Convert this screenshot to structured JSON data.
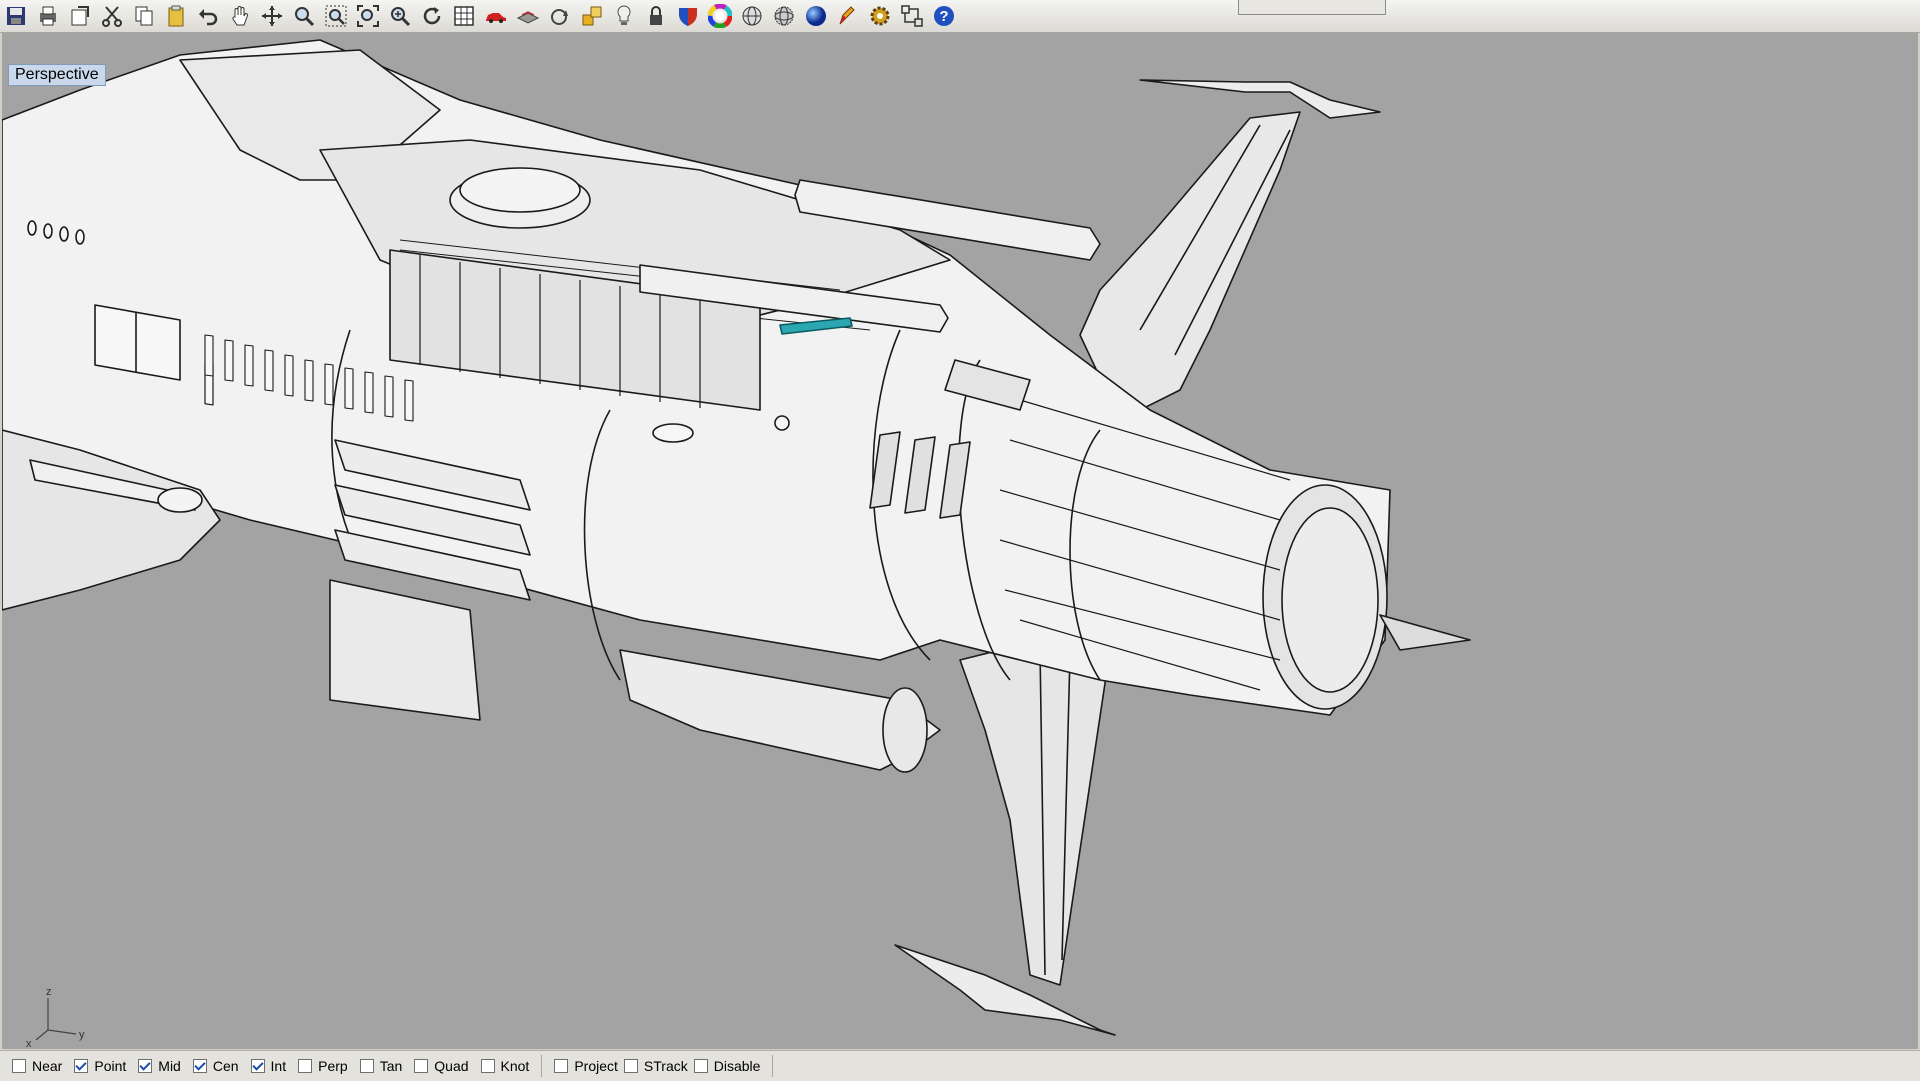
{
  "viewport": {
    "title": "Perspective"
  },
  "toolbar": {
    "icons": [
      "save-icon",
      "print-icon",
      "open-icon",
      "cut-icon",
      "copy-icon",
      "paste-icon",
      "undo-icon",
      "pan-hand-icon",
      "move-icon",
      "zoom-icon",
      "zoom-window-icon",
      "zoom-extents-icon",
      "zoom-selected-icon",
      "rotate-view-icon",
      "grid-icon",
      "car-render-icon",
      "layer-icon",
      "rotate-icon",
      "object-snap-icon",
      "light-icon",
      "lock-icon",
      "material-icon",
      "color-wheel-icon",
      "sphere-wire-icon",
      "mesh-icon",
      "render-sphere-icon",
      "pencil-icon",
      "settings-gear-icon",
      "structure-icon",
      "help-icon"
    ]
  },
  "axis": {
    "z": "z",
    "y": "y",
    "x": "x"
  },
  "osnaps": [
    {
      "label": "Near",
      "checked": false
    },
    {
      "label": "Point",
      "checked": true
    },
    {
      "label": "Mid",
      "checked": true
    },
    {
      "label": "Cen",
      "checked": true
    },
    {
      "label": "Int",
      "checked": true
    },
    {
      "label": "Perp",
      "checked": false
    },
    {
      "label": "Tan",
      "checked": false
    },
    {
      "label": "Quad",
      "checked": false
    },
    {
      "label": "Knot",
      "checked": false
    },
    {
      "label": "Project",
      "checked": false
    },
    {
      "label": "STrack",
      "checked": false
    },
    {
      "label": "Disable",
      "checked": false
    }
  ],
  "colors": {
    "viewport_bg": "#a3a3a3",
    "accent_cyan": "#2aa7b0",
    "help_blue": "#2050c0"
  }
}
